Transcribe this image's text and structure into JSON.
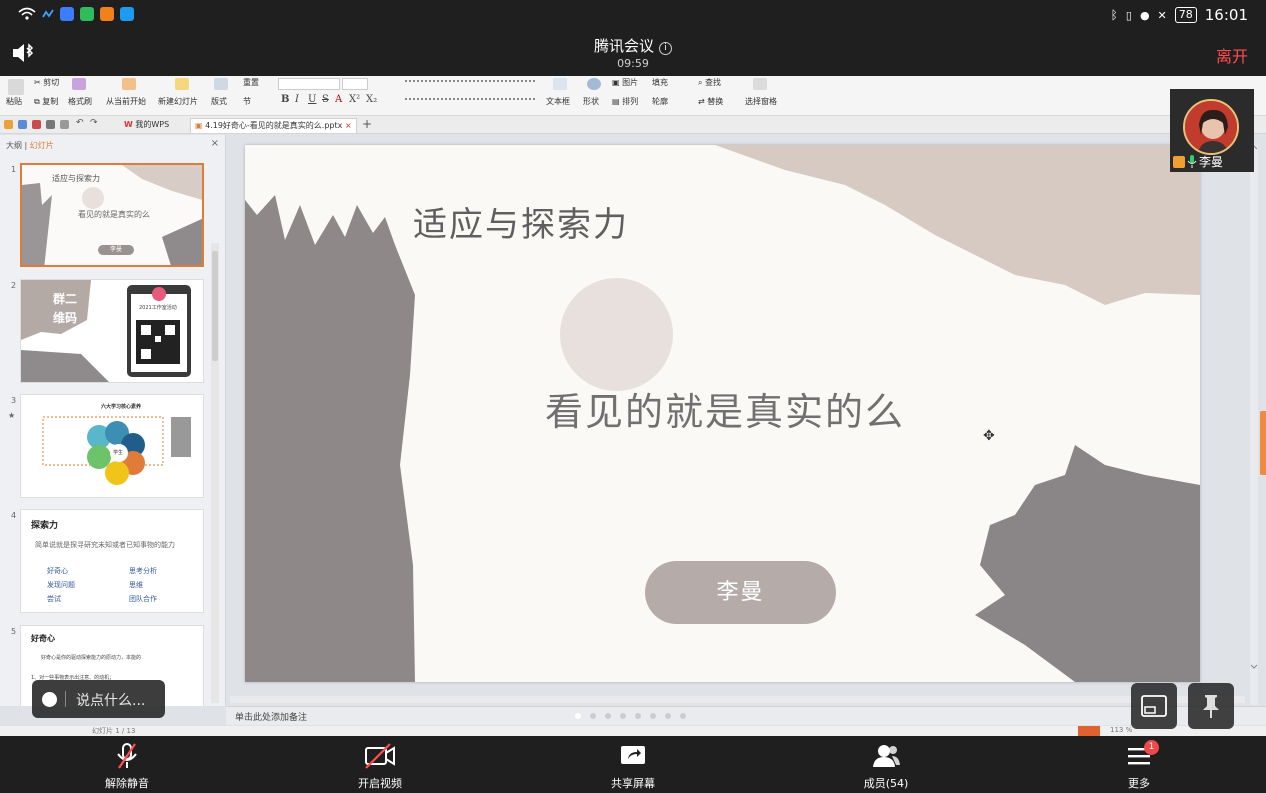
{
  "status_bar": {
    "battery": "78",
    "time": "16:01"
  },
  "meeting": {
    "title": "腾讯会议",
    "elapsed": "09:59",
    "leave_label": "离开"
  },
  "ribbon": {
    "paste": "粘贴",
    "cut": "剪切",
    "copy": "复制",
    "format_painter": "格式刷",
    "from_current": "从当前开始",
    "new_slide": "新建幻灯片",
    "layout": "版式",
    "section": "节",
    "reset": "重置",
    "text_box": "文本框",
    "shape": "形状",
    "picture": "图片",
    "arrange": "排列",
    "fill": "填充",
    "outline": "轮廓",
    "find": "查找",
    "replace": "替换",
    "select_pane": "选择窗格"
  },
  "tabs": {
    "wps": "我的WPS",
    "doc": "4.19好奇心-看见的就是真实的么.pptx"
  },
  "panel": {
    "outline": "大纲",
    "slides": "幻灯片",
    "thumbnails": [
      {
        "num": "1",
        "title": "适应与探索力",
        "subtitle": "看见的就是真实的么",
        "button": "李曼"
      },
      {
        "num": "2",
        "qr_label_1": "群二",
        "qr_label_2": "维码",
        "qr_caption": "2021工作室活动"
      },
      {
        "num": "3",
        "star": "★",
        "title": "六大学习核心素养",
        "center": "学生"
      },
      {
        "num": "4",
        "heading": "探索力",
        "line": "简单说就是探寻研究未知或者已知事物的能力",
        "col1": [
          "好奇心",
          "发现问题",
          "尝试"
        ],
        "col2": [
          "思考分析",
          "思维",
          "团队合作"
        ]
      },
      {
        "num": "5",
        "heading": "好奇心",
        "line1": "好奇心是你的驱动探索能力的原动力，本能的",
        "line2": "1、对一些事物表示出注意、的动机；"
      }
    ]
  },
  "slide": {
    "title": "适应与探索力",
    "subtitle": "看见的就是真实的么",
    "button": "李曼",
    "notes_placeholder": "单击此处添加备注",
    "slide_counter": "幻灯片 1 / 13",
    "zoom": "113 %",
    "dots_total": 8,
    "dots_active": 1
  },
  "participant": {
    "name": "李曼"
  },
  "chat": {
    "placeholder": "说点什么..."
  },
  "toolbar": {
    "unmute": "解除静音",
    "video": "开启视频",
    "share": "共享屏幕",
    "members": "成员(54)",
    "more": "更多",
    "more_badge": "1"
  },
  "colors": {
    "accent": "#e07b39",
    "leave": "#ff4d4f",
    "slide_button": "#b5aca9",
    "brush_gray": "#8a8586",
    "brush_beige": "#d6cac3"
  }
}
